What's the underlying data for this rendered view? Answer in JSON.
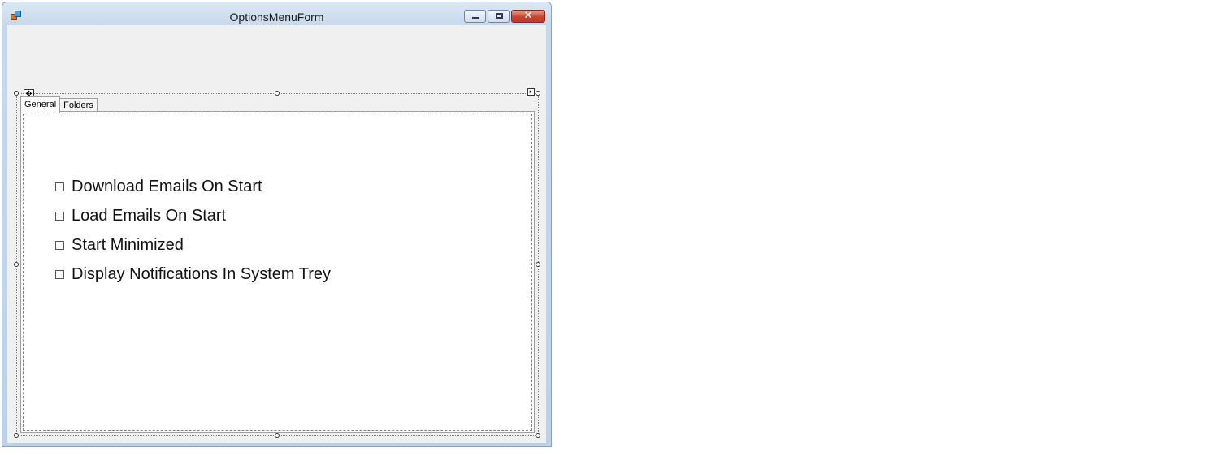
{
  "window": {
    "title": "OptionsMenuForm",
    "icon": "app-form-icon",
    "buttons": {
      "minimize": "minimize-icon",
      "maximize": "maximize-icon",
      "close_glyph": "✕"
    }
  },
  "tabs": [
    {
      "label": "General",
      "active": true
    },
    {
      "label": "Folders",
      "active": false
    }
  ],
  "general": {
    "checkboxes": [
      {
        "label": "Download Emails On Start",
        "checked": false
      },
      {
        "label": "Load Emails On Start",
        "checked": false
      },
      {
        "label": "Start Minimized",
        "checked": false
      },
      {
        "label": "Display Notifications In System Trey",
        "checked": false
      }
    ]
  },
  "designer": {
    "move_glyph": "✥",
    "smart_tag_glyph": "▸"
  }
}
